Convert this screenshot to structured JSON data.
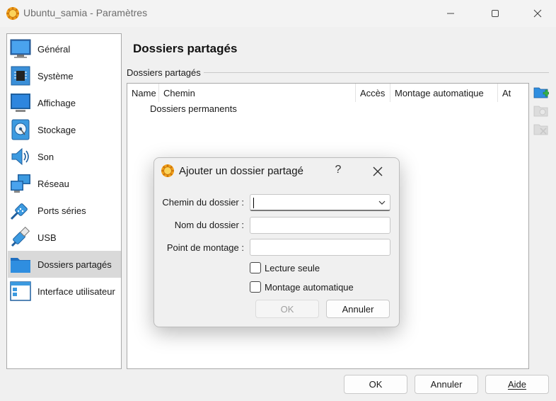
{
  "window": {
    "title": "Ubuntu_samia - Paramètres",
    "controls": [
      "minimize-icon",
      "maximize-icon",
      "close-icon"
    ]
  },
  "sidebar": {
    "items": [
      {
        "label": "Général",
        "icon": "monitor-icon"
      },
      {
        "label": "Système",
        "icon": "chip-icon"
      },
      {
        "label": "Affichage",
        "icon": "display-icon"
      },
      {
        "label": "Stockage",
        "icon": "disk-icon"
      },
      {
        "label": "Son",
        "icon": "speaker-icon"
      },
      {
        "label": "Réseau",
        "icon": "network-icon"
      },
      {
        "label": "Ports séries",
        "icon": "serial-port-icon"
      },
      {
        "label": "USB",
        "icon": "usb-icon"
      },
      {
        "label": "Dossiers partagés",
        "icon": "folder-icon",
        "selected": true
      },
      {
        "label": "Interface utilisateur",
        "icon": "window-layout-icon"
      }
    ]
  },
  "main": {
    "title": "Dossiers partagés",
    "group_label": "Dossiers partagés",
    "columns": [
      "Name",
      "Chemin",
      "Accès",
      "Montage automatique",
      "At"
    ],
    "tree_root": "Dossiers permanents",
    "tools": [
      "add-folder-icon",
      "edit-folder-icon",
      "remove-folder-icon"
    ]
  },
  "buttons": {
    "ok": "OK",
    "cancel": "Annuler",
    "help": "Aide"
  },
  "dialog": {
    "title": "Ajouter un dossier partagé",
    "help": "?",
    "path_label": "Chemin du dossier :",
    "path_value": "",
    "name_label": "Nom du dossier :",
    "name_value": "",
    "mount_label": "Point de montage :",
    "mount_value": "",
    "readonly_label": "Lecture seule",
    "readonly_checked": false,
    "automount_label": "Montage automatique",
    "automount_checked": false,
    "ok": "OK",
    "cancel": "Annuler"
  },
  "colors": {
    "selected_bg": "#d9d9d9",
    "accent": "#1f77d0",
    "folder_blue": "#2f8ee0"
  }
}
